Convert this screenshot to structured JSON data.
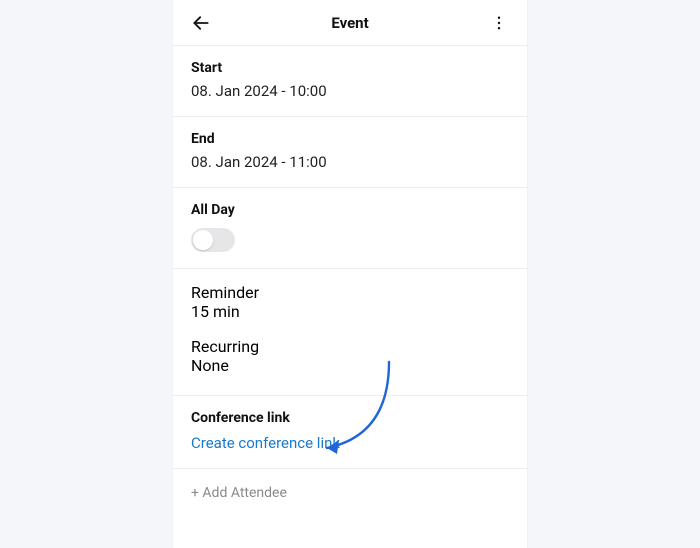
{
  "header": {
    "title": "Event"
  },
  "start": {
    "label": "Start",
    "value": "08. Jan 2024 - 10:00"
  },
  "end": {
    "label": "End",
    "value": "08. Jan 2024 - 11:00"
  },
  "allDay": {
    "label": "All Day",
    "on": false
  },
  "reminder": {
    "label": "Reminder",
    "value": "15 min"
  },
  "recurring": {
    "label": "Recurring",
    "value": "None"
  },
  "conference": {
    "label": "Conference link",
    "action": "Create conference link"
  },
  "addAttendee": {
    "label": "+ Add Attendee"
  },
  "colors": {
    "link": "#1a7ac7",
    "arrow": "#1f66d6"
  }
}
